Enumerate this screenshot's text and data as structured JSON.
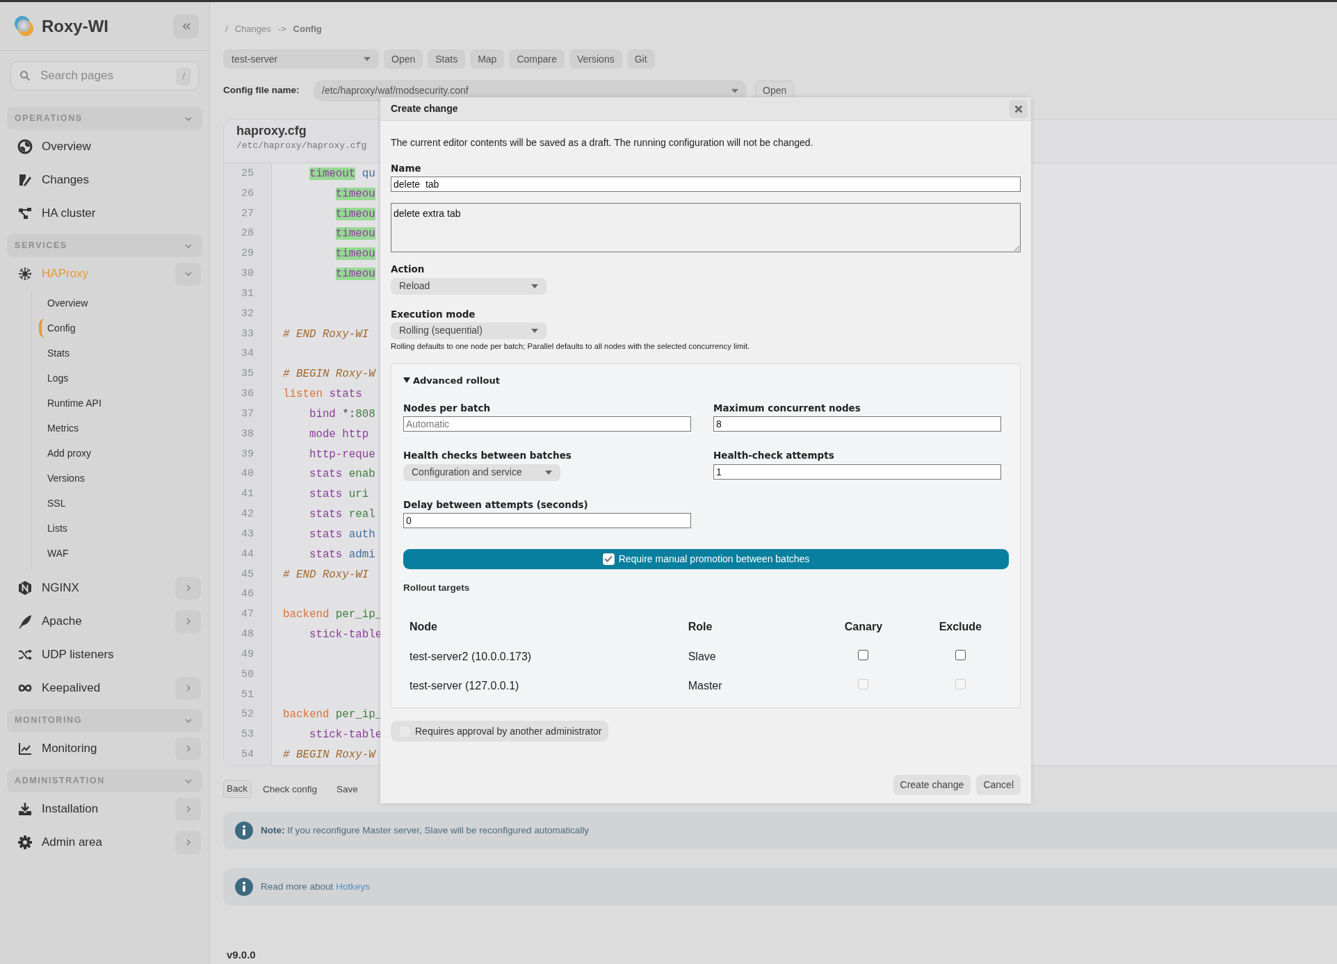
{
  "sidebar": {
    "brand": "Roxy-WI",
    "search": {
      "placeholder": "Search pages",
      "shortcut": "/"
    },
    "sections": [
      {
        "title": "OPERATIONS",
        "expanded": true,
        "items": [
          {
            "label": "Overview",
            "selected": false
          },
          {
            "label": "Changes",
            "selected": false
          },
          {
            "label": "HA cluster",
            "selected": false
          }
        ]
      },
      {
        "title": "SERVICES",
        "expanded": true,
        "items": [
          {
            "label": "HAProxy",
            "selected": true,
            "expanded": true,
            "children": [
              {
                "label": "Overview",
                "selected": false
              },
              {
                "label": "Config",
                "selected": true
              },
              {
                "label": "Stats",
                "selected": false
              },
              {
                "label": "Logs",
                "selected": false
              },
              {
                "label": "Runtime API",
                "selected": false
              },
              {
                "label": "Metrics",
                "selected": false
              },
              {
                "label": "Add proxy",
                "selected": false
              },
              {
                "label": "Versions",
                "selected": false
              },
              {
                "label": "SSL",
                "selected": false
              },
              {
                "label": "Lists",
                "selected": false
              },
              {
                "label": "WAF",
                "selected": false
              }
            ]
          },
          {
            "label": "NGINX",
            "selected": false,
            "expanded": false
          },
          {
            "label": "Apache",
            "selected": false,
            "expanded": false
          },
          {
            "label": "UDP listeners",
            "selected": false
          },
          {
            "label": "Keepalived",
            "selected": false,
            "expanded": false
          }
        ]
      },
      {
        "title": "MONITORING",
        "expanded": true,
        "items": [
          {
            "label": "Monitoring",
            "selected": false,
            "expanded": false
          }
        ]
      },
      {
        "title": "ADMINISTRATION",
        "expanded": true,
        "items": [
          {
            "label": "Installation",
            "selected": false,
            "expanded": false
          },
          {
            "label": "Admin area",
            "selected": false,
            "expanded": false
          }
        ]
      }
    ]
  },
  "breadcrumb": {
    "root": "/",
    "items": [
      "Changes",
      "Config"
    ],
    "separator": "->"
  },
  "toolbar": {
    "server_select": "test-server",
    "buttons": [
      "Open",
      "Stats",
      "Map",
      "Compare",
      "Versions",
      "Git"
    ]
  },
  "config_file": {
    "label": "Config file name:",
    "value": "/etc/haproxy/waf/modsecurity.conf",
    "button": "Open"
  },
  "editor": {
    "title": "haproxy.cfg",
    "path": "/etc/haproxy/haproxy.cfg",
    "lines": [
      {
        "number": "25",
        "tokens": [
          {
            "kind": "highlight",
            "text": "    timeout"
          },
          {
            "kind": "builtin",
            "text": " qu"
          }
        ]
      },
      {
        "number": "26",
        "tokens": [
          {
            "kind": "highlight",
            "text": "        timeou"
          }
        ]
      },
      {
        "number": "27",
        "tokens": [
          {
            "kind": "highlight",
            "text": "        timeou"
          }
        ]
      },
      {
        "number": "28",
        "tokens": [
          {
            "kind": "highlight",
            "text": "        timeou"
          }
        ]
      },
      {
        "number": "29",
        "tokens": [
          {
            "kind": "highlight",
            "text": "        timeou"
          }
        ]
      },
      {
        "number": "30",
        "tokens": [
          {
            "kind": "highlight",
            "text": "        timeou"
          }
        ]
      },
      {
        "number": "31"
      },
      {
        "number": "32"
      },
      {
        "number": "33",
        "tokens": [
          {
            "kind": "comment",
            "text": "# END Roxy-WI"
          }
        ]
      },
      {
        "number": "34"
      },
      {
        "number": "35",
        "tokens": [
          {
            "kind": "comment",
            "text": "# BEGIN Roxy-W"
          }
        ]
      },
      {
        "number": "36",
        "tokens": [
          {
            "kind": "keyword",
            "text": "listen"
          },
          {
            "kind": "directive",
            "text": " stats"
          }
        ]
      },
      {
        "number": "37",
        "tokens": [
          {
            "kind": "directive",
            "text": "    bind"
          },
          {
            "kind": "plain",
            "text": " *:"
          },
          {
            "kind": "value",
            "text": "808"
          }
        ]
      },
      {
        "number": "38",
        "tokens": [
          {
            "kind": "directive",
            "text": "    mode http"
          }
        ]
      },
      {
        "number": "39",
        "tokens": [
          {
            "kind": "directive",
            "text": "    http-reque"
          }
        ]
      },
      {
        "number": "40",
        "tokens": [
          {
            "kind": "directive",
            "text": "    stats"
          },
          {
            "kind": "value",
            "text": " enab"
          }
        ]
      },
      {
        "number": "41",
        "tokens": [
          {
            "kind": "directive",
            "text": "    stats"
          },
          {
            "kind": "value",
            "text": " uri"
          }
        ]
      },
      {
        "number": "42",
        "tokens": [
          {
            "kind": "directive",
            "text": "    stats"
          },
          {
            "kind": "value",
            "text": " real"
          }
        ]
      },
      {
        "number": "43",
        "tokens": [
          {
            "kind": "directive",
            "text": "    stats"
          },
          {
            "kind": "builtin",
            "text": " auth"
          }
        ]
      },
      {
        "number": "44",
        "tokens": [
          {
            "kind": "directive",
            "text": "    stats"
          },
          {
            "kind": "builtin",
            "text": " admi"
          }
        ]
      },
      {
        "number": "45",
        "tokens": [
          {
            "kind": "comment",
            "text": "# END Roxy-WI"
          }
        ]
      },
      {
        "number": "46"
      },
      {
        "number": "47",
        "tokens": [
          {
            "kind": "keyword",
            "text": "backend"
          },
          {
            "kind": "value",
            "text": " per_ip_"
          }
        ]
      },
      {
        "number": "48",
        "tokens": [
          {
            "kind": "directive",
            "text": "    stick-table"
          }
        ]
      },
      {
        "number": "49"
      },
      {
        "number": "50"
      },
      {
        "number": "51"
      },
      {
        "number": "52",
        "tokens": [
          {
            "kind": "keyword",
            "text": "backend"
          },
          {
            "kind": "value",
            "text": " per_ip_"
          }
        ]
      },
      {
        "number": "53",
        "tokens": [
          {
            "kind": "directive",
            "text": "    stick-table"
          }
        ]
      },
      {
        "number": "54",
        "tokens": [
          {
            "kind": "comment",
            "text": "# BEGIN Roxy-W"
          }
        ]
      }
    ]
  },
  "editor_buttons": [
    "Back",
    "Check config",
    "Save"
  ],
  "alerts": [
    {
      "text": "**Note:** If you reconfigure Master server, Slave will be reconfigured automatically"
    },
    {
      "text": "Read more about",
      "link": "Hotkeys"
    }
  ],
  "version": "v9.0.0",
  "modal": {
    "title": "Create change",
    "intro": "The current editor contents will be saved as a draft. The running configuration will not be changed.",
    "name": {
      "label": "Name",
      "value": "delete  tab"
    },
    "description": {
      "value": "delete extra tab"
    },
    "action": {
      "label": "Action",
      "value": "Reload"
    },
    "execution_mode": {
      "label": "Execution mode",
      "value": "Rolling (sequential)",
      "help": "Rolling defaults to one node per batch; Parallel defaults to all nodes with the selected concurrency limit."
    },
    "advanced": {
      "title": "Advanced rollout",
      "expanded": true,
      "fields": [
        {
          "kind": "input",
          "label": "Nodes per batch",
          "placeholder": "Automatic"
        },
        {
          "kind": "input",
          "label": "Maximum concurrent nodes",
          "value": "8"
        },
        {
          "kind": "select",
          "label": "Health checks between batches",
          "value": "Configuration and service"
        },
        {
          "kind": "input",
          "label": "Health-check attempts",
          "value": "1"
        },
        {
          "kind": "input",
          "label": "Delay between attempts (seconds)",
          "value": "0"
        }
      ],
      "manual_promotion": {
        "label": "Require manual promotion between batches",
        "checked": true
      },
      "targets": {
        "title": "Rollout targets",
        "columns": [
          "Node",
          "Role",
          "Canary",
          "Exclude"
        ],
        "rows": [
          {
            "node": "test-server2 (10.0.0.173)",
            "role": "Slave",
            "canary": false,
            "exclude": false,
            "disabled": false
          },
          {
            "node": "test-server (127.0.0.1)",
            "role": "Master",
            "canary": false,
            "exclude": false,
            "disabled": true
          }
        ]
      }
    },
    "approval": {
      "label": "Requires approval by another administrator",
      "checked": false
    },
    "buttons": [
      "Create change",
      "Cancel"
    ]
  }
}
